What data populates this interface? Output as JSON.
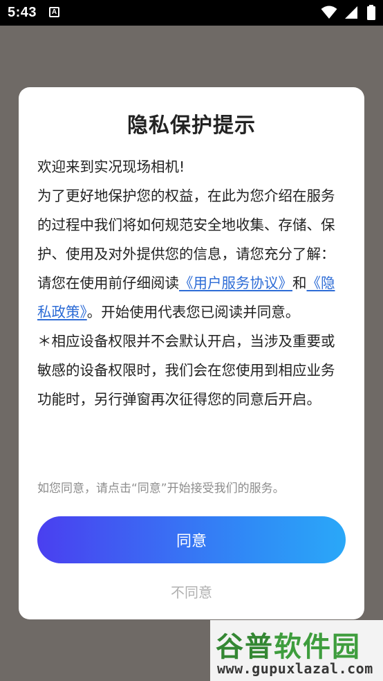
{
  "status_bar": {
    "time": "5:43",
    "a_icon": "A",
    "icons": [
      "wifi-icon",
      "signal-icon",
      "battery-icon"
    ]
  },
  "dialog": {
    "title": "隐私保护提示",
    "greeting": "欢迎来到实况现场相机!",
    "para1": "为了更好地保护您的权益，在此为您介绍在服务的过程中我们将如何规范安全地收集、存储、保护、使用及对外提供您的信息，请您充分了解：",
    "para2_prefix": "请您在使用前仔细阅读",
    "user_agreement_link": "《用户服务协议》",
    "para2_and": "和",
    "privacy_policy_link": "《隐私政策》",
    "para2_suffix": "。开始使用代表您已阅读并同意。",
    "para3": "＊相应设备权限并不会默认开启，当涉及重要或敏感的设备权限时，我们会在您使用到相应业务功能时，另行弹窗再次征得您的同意后开启。",
    "hint": "如您同意，请点击“同意”开始接受我们的服务。",
    "agree_label": "同意",
    "disagree_label": "不同意"
  },
  "watermark": {
    "brand_part1": "谷普",
    "brand_part2": "软件园",
    "url": "www.gupuxlazal.com"
  },
  "colors": {
    "link": "#2d6cd6",
    "button_gradient_start": "#4a3ff0",
    "button_gradient_end": "#2aa8f8",
    "overlay": "#6f6a66"
  }
}
